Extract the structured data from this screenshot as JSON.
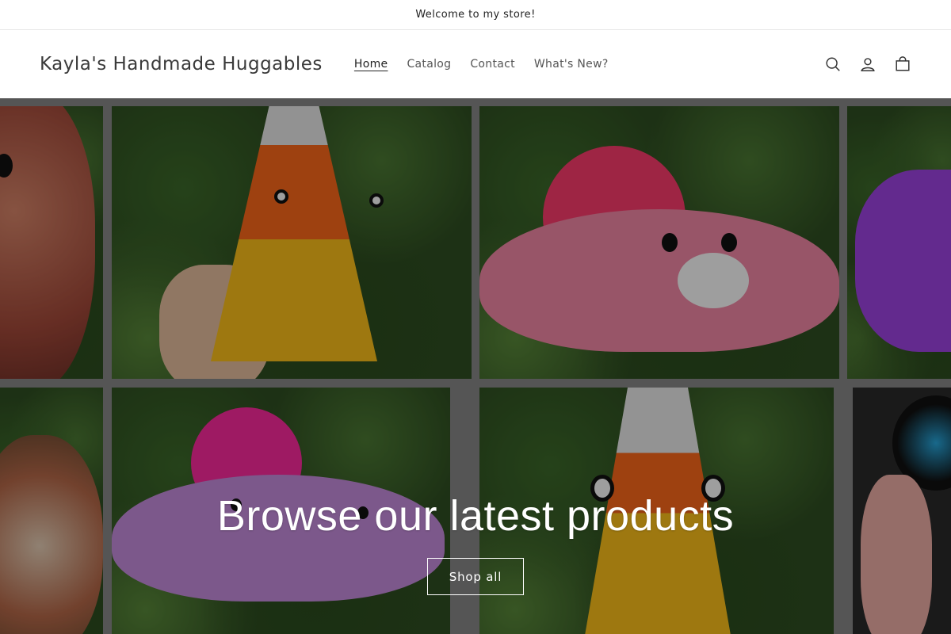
{
  "announcement": {
    "text": "Welcome to my store!"
  },
  "header": {
    "logo": "Kayla's Handmade Huggables",
    "nav": [
      {
        "label": "Home",
        "active": true
      },
      {
        "label": "Catalog",
        "active": false
      },
      {
        "label": "Contact",
        "active": false
      },
      {
        "label": "What's New?",
        "active": false
      }
    ],
    "icons": [
      "search-icon",
      "account-icon",
      "cart-icon"
    ]
  },
  "hero": {
    "title": "Browse our latest products",
    "button_label": "Shop all"
  },
  "colors": {
    "text": "#121212",
    "border": "#e6e6e6",
    "hero_overlay": "rgba(0,0,0,0.38)",
    "button_border": "#ffffff"
  }
}
